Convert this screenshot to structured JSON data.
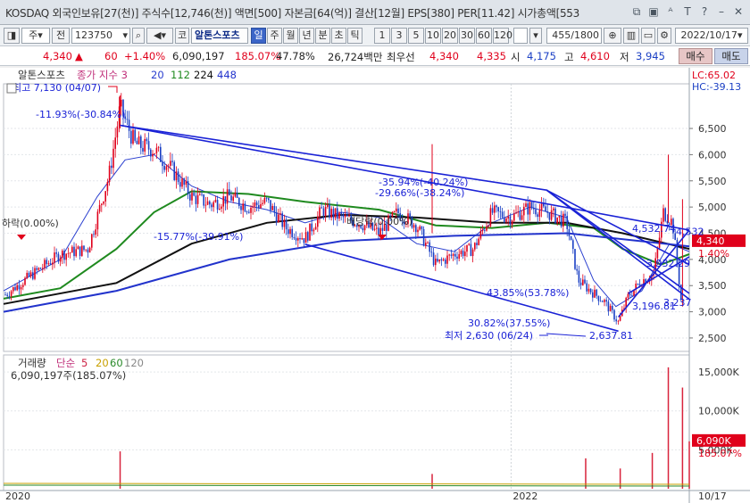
{
  "titlebar": {
    "text": "KOSDAQ 외국인보유[27(천)] 주식수[12,746(천)] 액면[500] 자본금[64(억)] 결산[12월] EPS[380] PER[11.42] 시가총액[553",
    "icons": [
      "window-icon",
      "lock-icon",
      "font-icon",
      "text-size-icon",
      "help-icon",
      "minimize-icon",
      "close-icon"
    ]
  },
  "toolbar": {
    "market": "주",
    "all": "전",
    "code": "123750",
    "stock_name": "알톤스포츠",
    "periods": [
      "일",
      "주",
      "월",
      "년",
      "분",
      "초",
      "틱"
    ],
    "selected_period": "일",
    "intervals": [
      "1",
      "3",
      "5",
      "10",
      "20",
      "30",
      "60",
      "120"
    ],
    "count": "455",
    "total": "/1800",
    "date": "2022/10/17"
  },
  "pricebar": {
    "price": "4,340",
    "change": "60",
    "change_pct": "+1.40%",
    "volume": "6,090,197",
    "volume_ratio": "185.07%",
    "turnover": "47.78%",
    "trade_value": "26,724백만",
    "best_ask_label": "최우선",
    "best_ask": "4,340",
    "best_bid": "4,335",
    "open_label": "시",
    "open": "4,175",
    "high_label": "고",
    "high": "4,610",
    "low_label": "저",
    "low": "3,945",
    "buy_label": "매수",
    "sell_label": "매도"
  },
  "chart_data": {
    "type": "candlestick",
    "stock": "알톤스포츠",
    "price_legend": {
      "label": "종가 지수 3",
      "ma_periods": [
        "20",
        "112",
        "224",
        "448"
      ],
      "colors": [
        "#2a3fcf",
        "#1f8a1f",
        "#111111",
        "#2233cc"
      ]
    },
    "y_axis": {
      "ticks": [
        "2,500",
        "3,000",
        "3,500",
        "4,000",
        "4,500",
        "5,000",
        "5,500",
        "6,000",
        "6,500"
      ],
      "range": [
        2380,
        7250
      ]
    },
    "x_axis": {
      "labels": [
        "2020",
        "2022",
        "10/17"
      ]
    },
    "last_price": "4,340",
    "last_change": "1.40%",
    "lc": "LC:65.02",
    "hc": "HC:-39.13",
    "price_axis_label": "4,532",
    "annotations": {
      "high": "최고 7,130 (04/07)",
      "low": "최저 2,630 (06/24)",
      "a1": "-11.93%(-30.84%)",
      "a2": "-35.94%(-40.24%)",
      "a3": "-29.66%(-38.24%)",
      "a4": "-15.77%(-39.91%)",
      "a5": "43.85%(53.78%)",
      "a6": "30.82%(37.55%)",
      "a7": "2,637.81",
      "a8": "4,532.74",
      "a9": "3,932.29",
      "a10": "3,196.81",
      "a11": "3,237",
      "a12": "하락(0.00%)",
      "a13": "배당락(0.00%)"
    },
    "trendlines": [
      {
        "x1": "2020-04-07",
        "y1": 6560,
        "x2": "2022-10-17",
        "y2": 4560
      },
      {
        "x1": "2020-04-07",
        "y1": 6560,
        "x2": "2022-03-01",
        "y2": 5320
      },
      {
        "x1": "2021-02-01",
        "y1": 4290,
        "x2": "2022-06-24",
        "y2": 2630
      },
      {
        "x1": "2022-02-28",
        "y1": 5320,
        "x2": "2022-10-17",
        "y2": 3240
      },
      {
        "x1": "2022-02-28",
        "y1": 5320,
        "x2": "2022-10-17",
        "y2": 3350
      },
      {
        "x1": "2022-02-28",
        "y1": 5320,
        "x2": "2022-10-17",
        "y2": 3900
      },
      {
        "x1": "2022-06-24",
        "y1": 2900,
        "x2": "2022-10-17",
        "y2": 4560
      },
      {
        "x1": "2022-07-10",
        "y1": 3350,
        "x2": "2022-10-17",
        "y2": 4050
      }
    ],
    "ma_series": [
      {
        "period": "20",
        "color": "#2a3fcf",
        "points": [
          [
            "2019-10-01",
            3400
          ],
          [
            "2020-01-01",
            4000
          ],
          [
            "2020-03-01",
            5200
          ],
          [
            "2020-04-15",
            5900
          ],
          [
            "2020-06-01",
            6000
          ],
          [
            "2020-08-01",
            5400
          ],
          [
            "2020-10-01",
            5100
          ],
          [
            "2020-12-01",
            4950
          ],
          [
            "2021-02-01",
            4700
          ],
          [
            "2021-04-01",
            4900
          ],
          [
            "2021-06-01",
            4800
          ],
          [
            "2021-08-01",
            4300
          ],
          [
            "2021-10-01",
            4150
          ],
          [
            "2021-12-01",
            4700
          ],
          [
            "2022-02-01",
            5000
          ],
          [
            "2022-04-01",
            4800
          ],
          [
            "2022-05-15",
            3600
          ],
          [
            "2022-06-20",
            3100
          ],
          [
            "2022-08-01",
            3400
          ],
          [
            "2022-09-15",
            4300
          ],
          [
            "2022-10-17",
            4150
          ]
        ]
      },
      {
        "period": "112",
        "color": "#1f8a1f",
        "points": [
          [
            "2019-10-01",
            3250
          ],
          [
            "2020-01-01",
            3450
          ],
          [
            "2020-04-01",
            4200
          ],
          [
            "2020-06-01",
            4900
          ],
          [
            "2020-08-01",
            5300
          ],
          [
            "2020-11-01",
            5250
          ],
          [
            "2021-02-01",
            5100
          ],
          [
            "2021-06-01",
            4950
          ],
          [
            "2021-09-01",
            4650
          ],
          [
            "2021-12-01",
            4600
          ],
          [
            "2022-03-01",
            4700
          ],
          [
            "2022-05-15",
            4600
          ],
          [
            "2022-07-01",
            4200
          ],
          [
            "2022-09-01",
            3900
          ],
          [
            "2022-10-17",
            4100
          ]
        ]
      },
      {
        "period": "224",
        "color": "#111111",
        "points": [
          [
            "2019-10-01",
            3150
          ],
          [
            "2020-04-01",
            3550
          ],
          [
            "2020-08-01",
            4300
          ],
          [
            "2020-12-01",
            4700
          ],
          [
            "2021-04-01",
            4850
          ],
          [
            "2021-08-01",
            4800
          ],
          [
            "2021-12-01",
            4700
          ],
          [
            "2022-04-01",
            4700
          ],
          [
            "2022-07-01",
            4500
          ],
          [
            "2022-10-17",
            4200
          ]
        ]
      },
      {
        "period": "448",
        "color": "#2233cc",
        "points": [
          [
            "2019-10-01",
            3000
          ],
          [
            "2020-04-01",
            3400
          ],
          [
            "2020-10-01",
            4000
          ],
          [
            "2021-04-01",
            4350
          ],
          [
            "2021-10-01",
            4450
          ],
          [
            "2022-04-01",
            4500
          ],
          [
            "2022-10-17",
            4250
          ]
        ]
      }
    ],
    "price_path": [
      [
        "2019-10-01",
        3300
      ],
      [
        "2019-11-15",
        3700
      ],
      [
        "2020-01-01",
        4100
      ],
      [
        "2020-02-15",
        4200
      ],
      [
        "2020-03-20",
        5600
      ],
      [
        "2020-04-07",
        6900
      ],
      [
        "2020-05-01",
        6200
      ],
      [
        "2020-06-01",
        6100
      ],
      [
        "2020-07-01",
        5700
      ],
      [
        "2020-08-01",
        5200
      ],
      [
        "2020-09-01",
        5050
      ],
      [
        "2020-10-01",
        5200
      ],
      [
        "2020-11-01",
        5000
      ],
      [
        "2020-12-01",
        5100
      ],
      [
        "2021-01-01",
        4600
      ],
      [
        "2021-02-01",
        4400
      ],
      [
        "2021-03-01",
        4950
      ],
      [
        "2021-04-01",
        4800
      ],
      [
        "2021-05-01",
        4700
      ],
      [
        "2021-06-01",
        4500
      ],
      [
        "2021-07-01",
        4900
      ],
      [
        "2021-08-01",
        4650
      ],
      [
        "2021-09-01",
        3900
      ],
      [
        "2021-10-01",
        4100
      ],
      [
        "2021-11-01",
        4200
      ],
      [
        "2021-12-01",
        4900
      ],
      [
        "2022-01-01",
        4800
      ],
      [
        "2022-02-01",
        5000
      ],
      [
        "2022-03-01",
        4900
      ],
      [
        "2022-04-01",
        4700
      ],
      [
        "2022-04-20",
        3600
      ],
      [
        "2022-05-10",
        3400
      ],
      [
        "2022-06-01",
        3200
      ],
      [
        "2022-06-24",
        2800
      ],
      [
        "2022-07-10",
        3300
      ],
      [
        "2022-08-01",
        3600
      ],
      [
        "2022-08-20",
        3700
      ],
      [
        "2022-09-05",
        4900
      ],
      [
        "2022-09-20",
        4700
      ],
      [
        "2022-10-05",
        3100
      ],
      [
        "2022-10-17",
        4340
      ]
    ],
    "volume": {
      "legend_label": "거래량",
      "legend_ma": "단순",
      "legend_periods": [
        "5",
        "20",
        "60",
        "120"
      ],
      "legend_colors": [
        "#cc2244",
        "#c8a000",
        "#2a8a2a",
        "#888888"
      ],
      "info": "6,090,197주(185.07%)",
      "y_ticks": [
        "5,000K",
        "10,000K",
        "15,000K"
      ],
      "range": [
        0,
        16500
      ],
      "last": "6,090K",
      "last_pct": "185.07%",
      "spikes": [
        [
          "2020-04-07",
          4800
        ],
        [
          "2021-08-26",
          1900
        ],
        [
          "2022-05-02",
          3900
        ],
        [
          "2022-06-27",
          2600
        ],
        [
          "2022-08-18",
          4600
        ],
        [
          "2022-09-13",
          15600
        ],
        [
          "2022-10-06",
          13000
        ],
        [
          "2022-10-17",
          6090
        ]
      ]
    }
  }
}
